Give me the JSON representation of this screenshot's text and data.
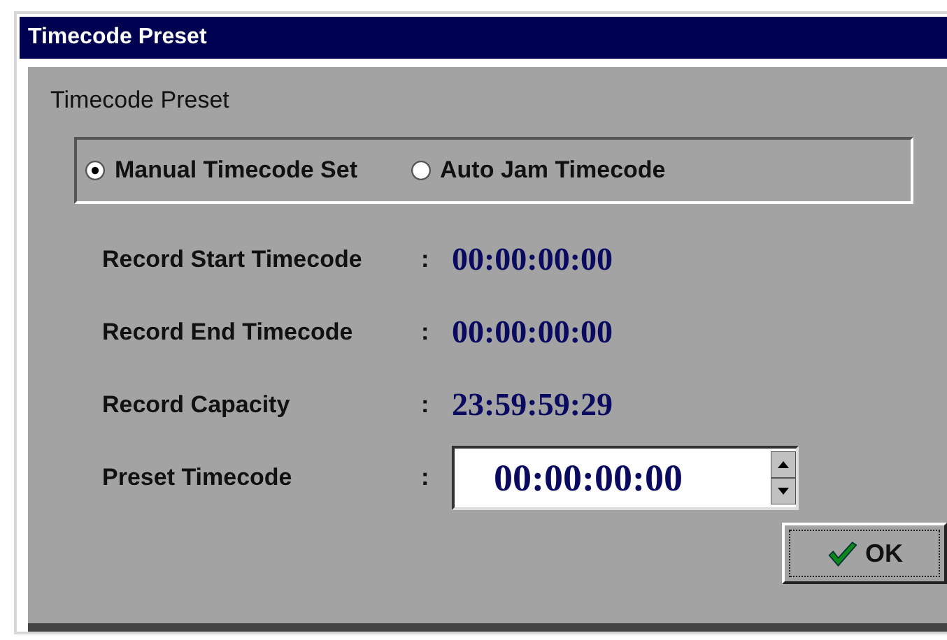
{
  "window": {
    "title": "Timecode Preset"
  },
  "section_title": "Timecode Preset",
  "modes": [
    {
      "label": "Manual Timecode Set",
      "selected": true
    },
    {
      "label": "Auto Jam Timecode",
      "selected": false
    }
  ],
  "readouts": [
    {
      "label": "Record Start Timecode",
      "colon": ":",
      "value": "00:00:00:00"
    },
    {
      "label": "Record End Timecode",
      "colon": ":",
      "value": "00:00:00:00"
    },
    {
      "label": "Record Capacity",
      "colon": ":",
      "value": "23:59:59:29"
    }
  ],
  "preset": {
    "label": "Preset Timecode",
    "colon": ":",
    "value": "00:00:00:00"
  },
  "buttons": [
    {
      "label": "OK"
    }
  ]
}
